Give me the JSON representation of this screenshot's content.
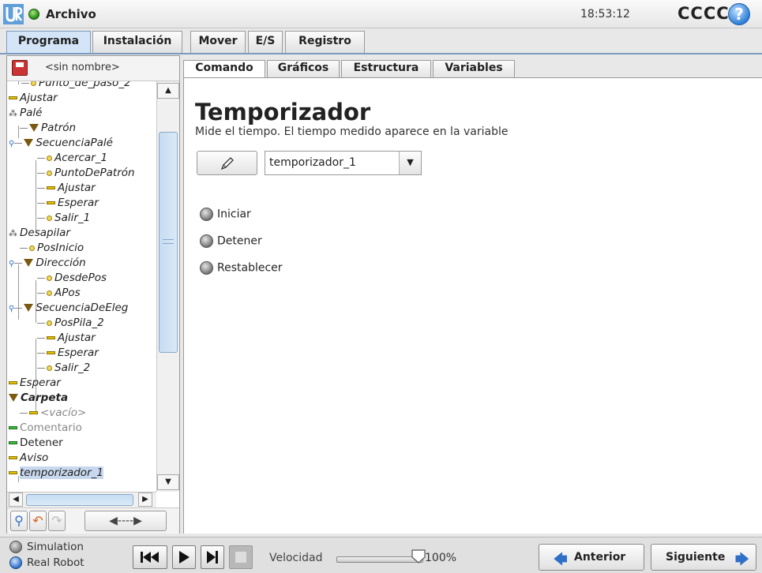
{
  "topbar": {
    "app_title": "Archivo",
    "clock": "18:53:12",
    "robot_name": "CCCC",
    "help": "?"
  },
  "main_tabs": [
    "Programa",
    "Instalación",
    "Mover",
    "E/S",
    "Registro"
  ],
  "program": {
    "name": "<sin nombre>",
    "tree": [
      {
        "label": "Punto_de_paso_2",
        "icon": "waypoint"
      },
      {
        "label": "Ajustar",
        "icon": "bar"
      },
      {
        "label": "Palé",
        "icon": "pallet"
      },
      {
        "label": "Patrón",
        "icon": "folder"
      },
      {
        "label": "SecuenciaPalé",
        "icon": "folder"
      },
      {
        "label": "Acercar_1",
        "icon": "waypoint"
      },
      {
        "label": "PuntoDePatrón",
        "icon": "waypoint"
      },
      {
        "label": "Ajustar",
        "icon": "bar"
      },
      {
        "label": "Esperar",
        "icon": "bar"
      },
      {
        "label": "Salir_1",
        "icon": "waypoint"
      },
      {
        "label": "Desapilar",
        "icon": "pallet"
      },
      {
        "label": "PosInicio",
        "icon": "waypoint"
      },
      {
        "label": "Dirección",
        "icon": "folder"
      },
      {
        "label": "DesdePos",
        "icon": "waypoint"
      },
      {
        "label": "APos",
        "icon": "waypoint"
      },
      {
        "label": "SecuenciaDeEleg",
        "icon": "folder"
      },
      {
        "label": "PosPila_2",
        "icon": "waypoint"
      },
      {
        "label": "Ajustar",
        "icon": "bar"
      },
      {
        "label": "Esperar",
        "icon": "bar"
      },
      {
        "label": "Salir_2",
        "icon": "waypoint"
      },
      {
        "label": "Esperar",
        "icon": "bar"
      },
      {
        "label": "Carpeta",
        "icon": "folder"
      },
      {
        "label": "<vacío>",
        "icon": "bar"
      },
      {
        "label": "Comentario",
        "icon": "bar-green"
      },
      {
        "label": "Detener",
        "icon": "bar-green"
      },
      {
        "label": "Aviso",
        "icon": "bar"
      },
      {
        "label": "temporizador_1",
        "icon": "bar",
        "selected": true
      }
    ]
  },
  "sub_tabs": [
    "Comando",
    "Gráficos",
    "Estructura",
    "Variables"
  ],
  "command": {
    "title": "Temporizador",
    "description": "Mide el tiempo. El tiempo medido aparece en la variable",
    "variable": "temporizador_1",
    "options": [
      "Iniciar",
      "Detener",
      "Restablecer"
    ]
  },
  "bottom": {
    "modes": [
      "Simulation",
      "Real Robot"
    ],
    "speed_label": "Velocidad",
    "speed_value": "100%",
    "speed_fraction": 1.0,
    "prev_label": "Anterior",
    "next_label": "Siguiente"
  },
  "colors": {
    "accent": "#2f6fc8",
    "tab_active": "#d4e5f7",
    "selection": "#c8d8ee"
  }
}
